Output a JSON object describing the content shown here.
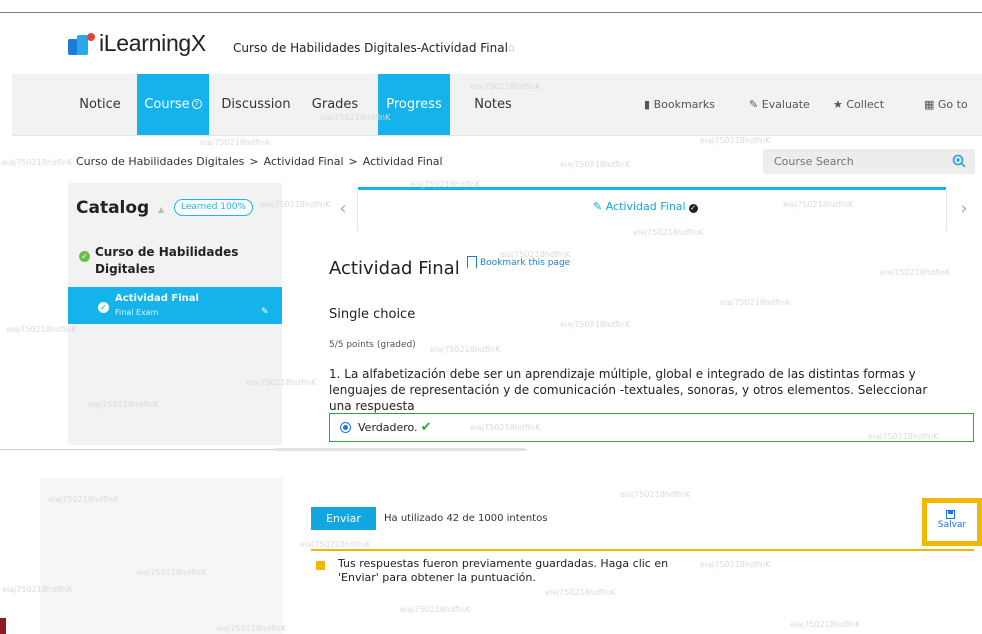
{
  "brand": {
    "name": "iLearningX"
  },
  "header": {
    "course_title": "Curso de Habilidades Digitales-Actividad Final"
  },
  "nav": {
    "items": [
      {
        "label": "Notice"
      },
      {
        "label": "Course"
      },
      {
        "label": "Discussion"
      },
      {
        "label": "Grades"
      },
      {
        "label": "Progress"
      },
      {
        "label": "Notes"
      }
    ],
    "right": {
      "bookmarks": "Bookmarks",
      "evaluate": "Evaluate",
      "collect": "Collect",
      "go_to_app": "Go to App"
    }
  },
  "breadcrumb": [
    "Curso de Habilidades Digitales",
    "Actividad Final",
    "Actividad Final"
  ],
  "search": {
    "placeholder": "Course Search"
  },
  "sidebar": {
    "title": "Catalog",
    "learned": "Learned 100%",
    "section": "Curso de Habilidades Digitales",
    "unit_title": "Actividad Final",
    "unit_subtitle": "Final Exam"
  },
  "sequence": {
    "tab_label": "Actividad Final"
  },
  "unit": {
    "heading": "Actividad Final",
    "bookmark": "Bookmark this page",
    "problem_type": "Single choice",
    "points": "5/5 points (graded)",
    "question": "1. La alfabetización debe ser un aprendizaje múltiple, global e integrado de las distintas formas y lenguajes de representación y de comunicación -textuales, sonoras, y otros elementos. Seleccionar una respuesta",
    "answer": "Verdadero."
  },
  "actions": {
    "submit": "Enviar",
    "attempts": "Ha utilizado 42 de 1000 intentos",
    "save": "Salvar",
    "notice": "Tus respuestas fueron previamente guardadas. Haga clic en 'Enviar' para obtener la puntuación."
  },
  "watermark": "eiaj750218hdflnK",
  "colors": {
    "accent": "#14b3ec",
    "success": "#2fa53c",
    "warning": "#f2b705"
  }
}
